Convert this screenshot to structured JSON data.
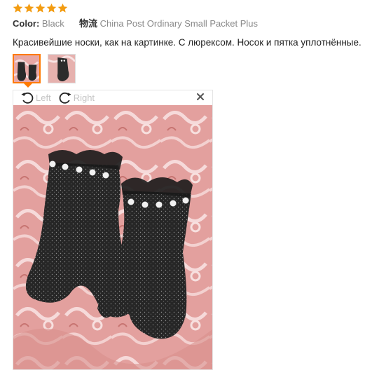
{
  "review": {
    "rating": 5,
    "star_color": "#f39c12",
    "color_label": "Color:",
    "color_value": "Black",
    "shipping_label": "物流",
    "shipping_value": "China Post Ordinary Small Packet Plus",
    "text": "Красивейшие носки, как на картинке. С люрексом. Носок и пятка уплотнённые.",
    "thumbnails": [
      {
        "icon": "socks-photo-thumbnail",
        "active": true
      },
      {
        "icon": "socks-photo-thumbnail",
        "active": false
      }
    ]
  },
  "viewer": {
    "rotate_left_label": "Left",
    "rotate_right_label": "Right",
    "rotate_left_icon": "rotate-left-icon",
    "rotate_right_icon": "rotate-right-icon",
    "close_icon": "close-icon",
    "accent_color": "#ff7a00"
  }
}
